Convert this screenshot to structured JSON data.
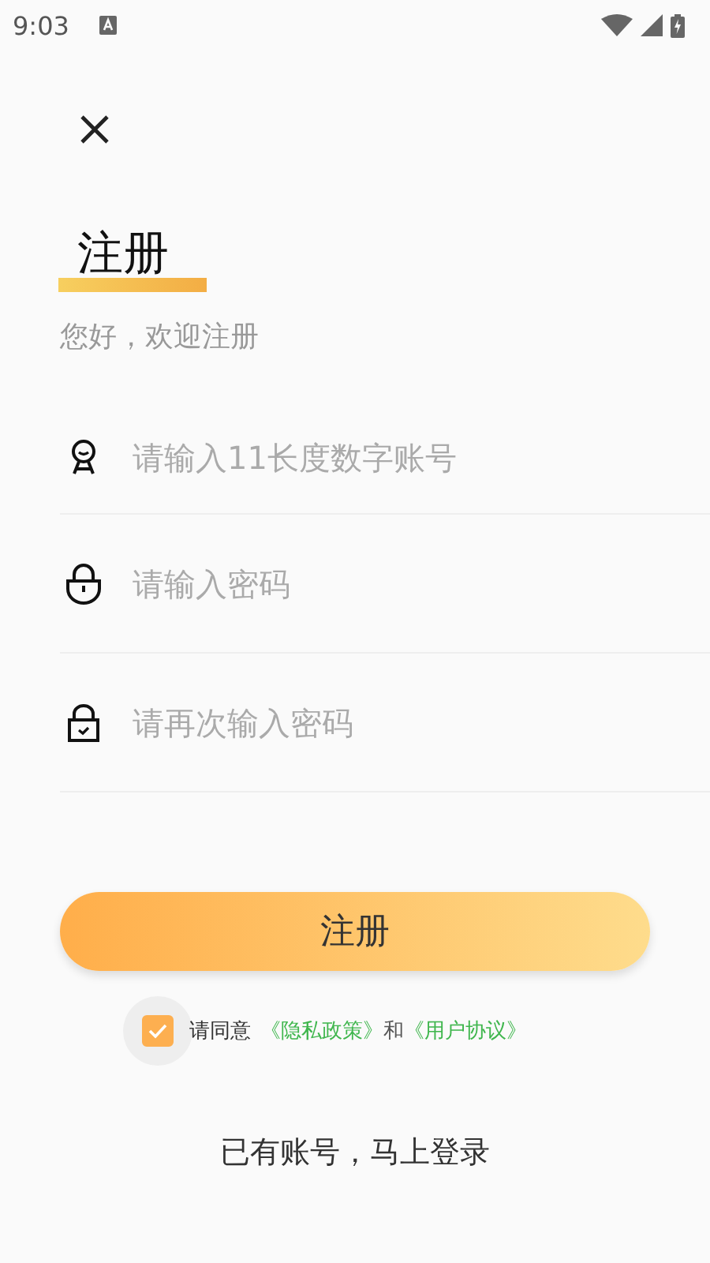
{
  "status_bar": {
    "time": "9:03"
  },
  "title": "注册",
  "subtitle": "您好，欢迎注册",
  "fields": [
    {
      "kind": "user",
      "placeholder": "请输入11长度数字账号"
    },
    {
      "kind": "lock",
      "placeholder": "请输入密码"
    },
    {
      "kind": "lock-check",
      "placeholder": "请再次输入密码"
    }
  ],
  "submit_button": "注册",
  "agreement": {
    "checked": true,
    "prefix": "请同意",
    "link_1": "《隐私政策》",
    "joiner": "和",
    "link_2": "《用户协议》"
  },
  "login_link": "已有账号，马上登录"
}
